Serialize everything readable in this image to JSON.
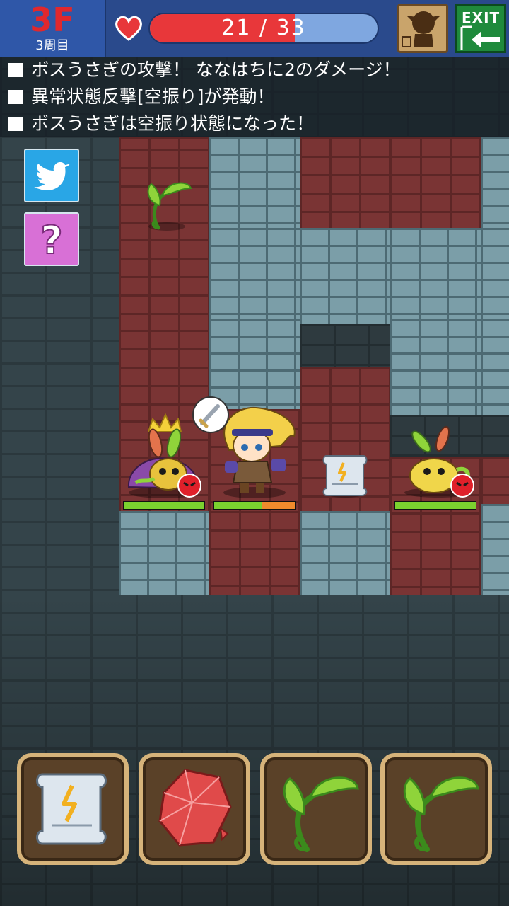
{
  "hud": {
    "floor": "3F",
    "lap": "3周目",
    "hp_current": 21,
    "hp_max": 33,
    "hp_text": "21 / 33",
    "hp_fraction": 0.636,
    "exit_label": "EXIT"
  },
  "log": [
    "ボスうさぎの攻撃！ ななはちに2のダメージ！",
    "異常状態反撃[空振り]が発動！",
    "ボスうさぎは空振り状態になった！"
  ],
  "side_buttons": [
    {
      "name": "twitter-button",
      "icon": "twitter-bird-icon"
    },
    {
      "name": "help-button",
      "icon": "question-mark-icon"
    }
  ],
  "map": {
    "entities": [
      {
        "name": "boss-rabbit",
        "icon": "crowned-rabbit-enemy-icon",
        "hp_fraction": 1.0
      },
      {
        "name": "player-nanahachi",
        "icon": "blonde-adventurer-icon",
        "hp_fraction": 0.6
      },
      {
        "name": "rabbit-enemy",
        "icon": "rabbit-enemy-icon",
        "hp_fraction": 1.0
      },
      {
        "name": "floor-item-scroll",
        "icon": "thunder-scroll-icon"
      },
      {
        "name": "floor-item-herb",
        "icon": "herb-icon"
      }
    ]
  },
  "inventory": [
    {
      "icon": "thunder-scroll-icon"
    },
    {
      "icon": "red-crystal-icon"
    },
    {
      "icon": "herb-icon"
    },
    {
      "icon": "herb-icon"
    }
  ],
  "colors": {
    "hud_bg": "#2a4a8c",
    "floor_text": "#e0282d",
    "hp_fill": "#e8373a",
    "hp_empty": "#7fa7e0",
    "enemy_hp": "#7bd12f",
    "player_hp_low": "#f08b2c"
  }
}
